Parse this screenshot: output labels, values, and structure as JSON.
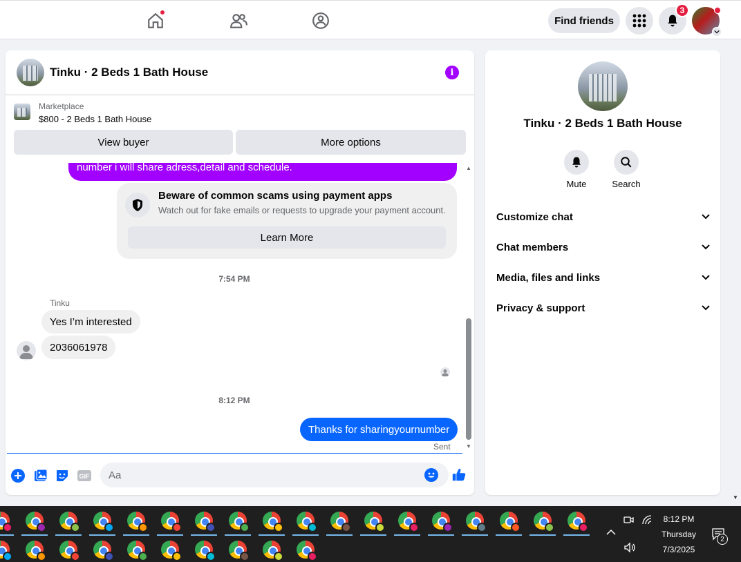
{
  "topnav": {
    "find_friends": "Find friends",
    "notifications_count": "3"
  },
  "chat": {
    "title": "Tinku · 2 Beds 1 Bath House",
    "marketplace_label": "Marketplace",
    "listing": "$800 - 2 Beds 1 Bath House",
    "view_buyer": "View buyer",
    "more_options": "More options",
    "prev_message": "number i will share adress,detail and schedule.",
    "scam_title": "Beware of common scams using payment apps",
    "scam_text": "Watch out for fake emails or requests to upgrade your payment account.",
    "learn_more": "Learn More",
    "time1": "7:54 PM",
    "sender": "Tinku",
    "msg1": "Yes I’m interested",
    "msg2": "2036061978",
    "time2": "8:12 PM",
    "my_msg": "Thanks for sharingyournumber",
    "sent_status": "Sent",
    "input_placeholder": "Aa"
  },
  "info": {
    "name": "Tinku · 2 Beds 1 Bath House",
    "mute": "Mute",
    "search": "Search",
    "sections": [
      "Customize chat",
      "Chat members",
      "Media, files and links",
      "Privacy & support"
    ]
  },
  "taskbar": {
    "time": "8:12 PM",
    "day": "Thursday",
    "date": "7/3/2025",
    "notif_count": "2"
  },
  "colors": {
    "accent_blue": "#0866ff",
    "purple": "#a200ff",
    "badge_red": "#e41e3f"
  }
}
